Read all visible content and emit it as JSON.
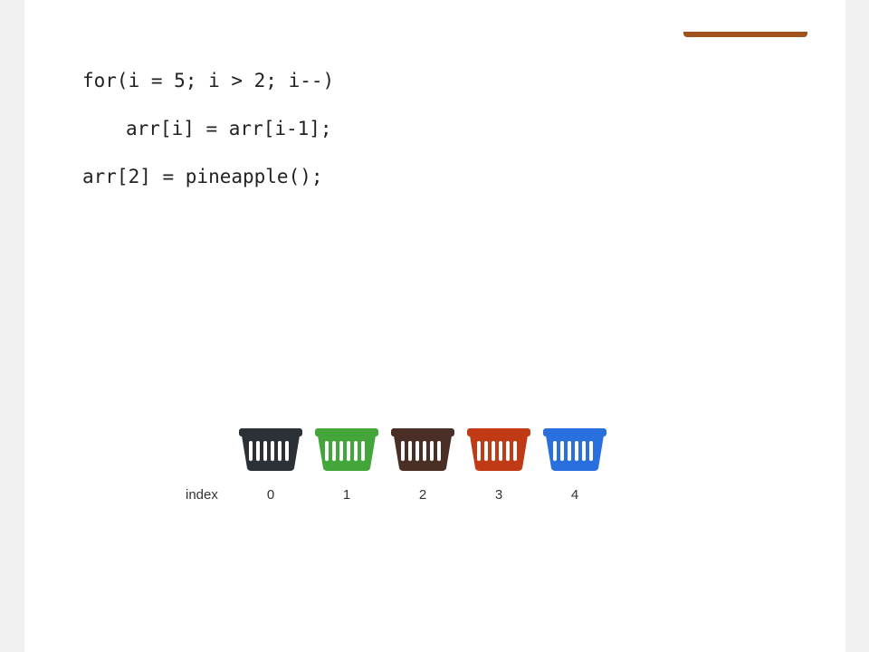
{
  "code": {
    "line1": "for(i = 5; i > 2; i--)",
    "line2": "arr[i] = arr[i-1];",
    "line3": "arr[2] = pineapple();"
  },
  "array": {
    "index_label": "index",
    "cells": [
      {
        "index": "0",
        "icon": "basket-icon",
        "color": "#2b3137"
      },
      {
        "index": "1",
        "icon": "basket-icon",
        "color": "#43a53a"
      },
      {
        "index": "2",
        "icon": "basket-icon",
        "color": "#4a2f26"
      },
      {
        "index": "3",
        "icon": "basket-icon",
        "color": "#c03a16"
      },
      {
        "index": "4",
        "icon": "basket-icon",
        "color": "#2a6fde"
      }
    ]
  },
  "colors": {
    "top_bar": "#a0521c",
    "text": "#222222"
  }
}
